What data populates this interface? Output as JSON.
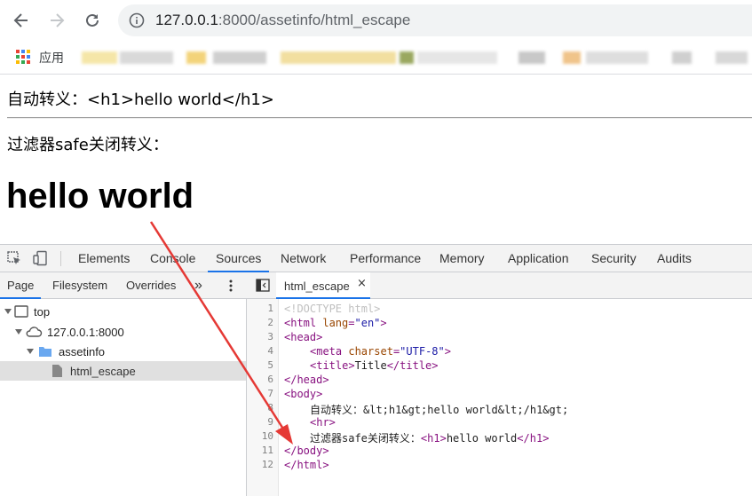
{
  "browser": {
    "url_host": "127.0.0.1",
    "url_rest": ":8000/assetinfo/html_escape",
    "bookmarks_apps_label": "应用"
  },
  "page": {
    "line1": "自动转义：<h1>hello world</h1>",
    "line2": "过滤器safe关闭转义：",
    "heading": "hello world"
  },
  "devtools": {
    "tabs": [
      "Elements",
      "Console",
      "Sources",
      "Network",
      "Performance",
      "Memory",
      "Application",
      "Security",
      "Audits"
    ],
    "active_tab": "Sources",
    "left_tabs": [
      "Page",
      "Filesystem",
      "Overrides"
    ],
    "more_label": "»",
    "tree": [
      "top",
      "127.0.0.1:8000",
      "assetinfo",
      "html_escape"
    ],
    "editor_tab": "html_escape",
    "close_glyph": "×",
    "line_numbers": [
      "1",
      "2",
      "3",
      "4",
      "5",
      "6",
      "7",
      "8",
      "9",
      "10",
      "11",
      "12"
    ],
    "code": {
      "l1": "<!DOCTYPE html>",
      "l2_open": "<html ",
      "l2_attr": "lang",
      "l2_eq": "=",
      "l2_val": "\"en\"",
      "l2_close": ">",
      "l3": "<head>",
      "l4_open": "<meta ",
      "l4_attr": "charset",
      "l4_eq": "=",
      "l4_val": "\"UTF-8\"",
      "l4_close": ">",
      "l5_open": "<title>",
      "l5_text": "Title",
      "l5_close": "</title>",
      "l6": "</head>",
      "l7": "<body>",
      "l8": "自动转义：&lt;h1&gt;hello world&lt;/h1&gt;",
      "l9": "<hr>",
      "l10_text": "过滤器safe关闭转义：",
      "l10_open": "<h1>",
      "l10_inner": "hello world",
      "l10_close": "</h1>",
      "l11": "</body>",
      "l12": "</html>"
    }
  },
  "colors": {
    "accent": "#1a73e8",
    "arrow": "#e53935"
  }
}
